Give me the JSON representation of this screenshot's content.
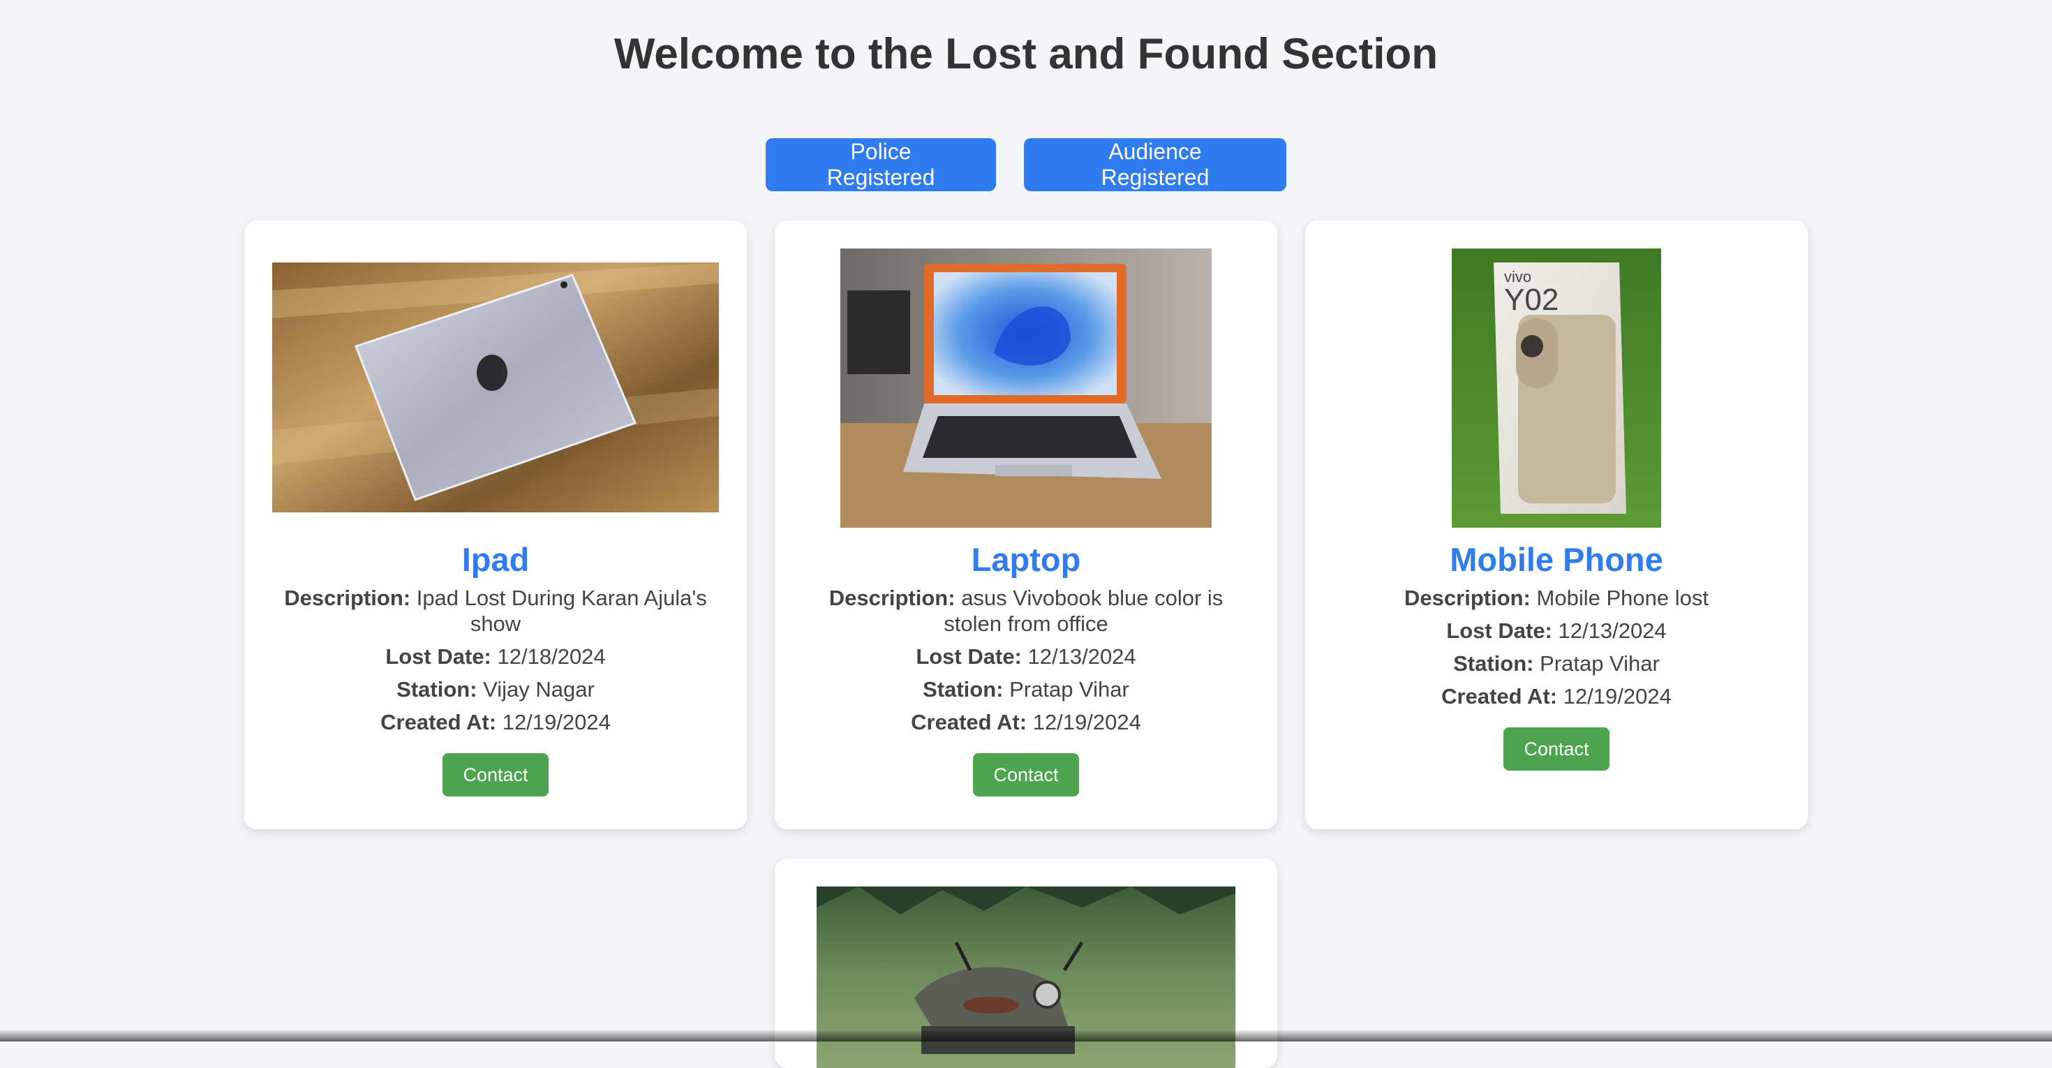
{
  "header": {
    "title": "Welcome to the Lost and Found Section"
  },
  "tabs": [
    {
      "label": "Police Registered"
    },
    {
      "label": "Audience Registered"
    }
  ],
  "labels": {
    "description": "Description:",
    "lost_date": "Lost Date:",
    "station": "Station:",
    "created_at": "Created At:",
    "contact": "Contact"
  },
  "items": [
    {
      "title": "Ipad",
      "description": "Ipad Lost During Karan Ajula's show",
      "lost_date": "12/18/2024",
      "station": "Vijay Nagar",
      "created_at": "12/19/2024"
    },
    {
      "title": "Laptop",
      "description": "asus Vivobook blue color is stolen from office",
      "lost_date": "12/13/2024",
      "station": "Pratap Vihar",
      "created_at": "12/19/2024"
    },
    {
      "title": "Mobile Phone",
      "description": "Mobile Phone lost",
      "lost_date": "12/13/2024",
      "station": "Pratap Vihar",
      "created_at": "12/19/2024"
    }
  ],
  "images": {
    "phone_box_text_top": "vivo",
    "phone_box_text_model": "Y02"
  },
  "colors": {
    "accent": "#2f7bf0",
    "contact": "#4ca44f",
    "background": "#f4f5f9"
  }
}
